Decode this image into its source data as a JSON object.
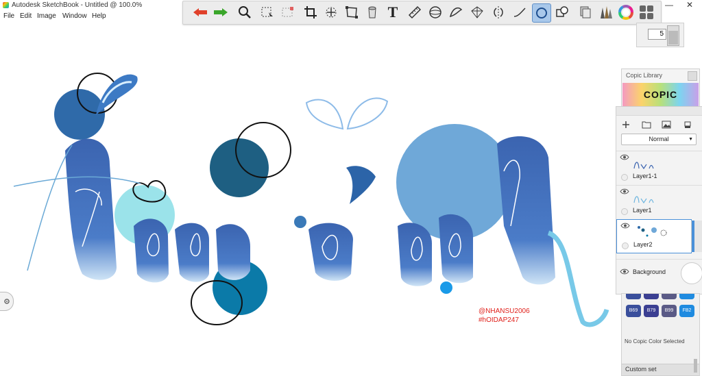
{
  "app": {
    "title": "Autodesk SketchBook - Untitled @ 100.0%",
    "window_controls": {
      "minimize": "—",
      "close": "✕"
    }
  },
  "menu": [
    "File",
    "Edit",
    "Image",
    "Window",
    "Help"
  ],
  "toolbar": {
    "tools": [
      {
        "name": "undo",
        "icon": "undo-arrow-icon",
        "color": "#e0402a"
      },
      {
        "name": "redo",
        "icon": "redo-arrow-icon",
        "color": "#3aa62a"
      },
      {
        "name": "zoom",
        "icon": "magnifier-icon"
      },
      {
        "name": "select",
        "icon": "selection-marquee-icon"
      },
      {
        "name": "lasso-select",
        "icon": "dashed-selection-icon"
      },
      {
        "name": "crop",
        "icon": "crop-icon"
      },
      {
        "name": "move-rotate",
        "icon": "transform-icon"
      },
      {
        "name": "distort",
        "icon": "distort-icon"
      },
      {
        "name": "fill",
        "icon": "bucket-icon"
      },
      {
        "name": "text",
        "icon": "text-icon",
        "label": "T"
      },
      {
        "name": "ruler",
        "icon": "ruler-icon"
      },
      {
        "name": "ellipse-guide",
        "icon": "ellipse-guide-icon"
      },
      {
        "name": "french-curve",
        "icon": "french-curve-icon"
      },
      {
        "name": "perspective",
        "icon": "perspective-icon"
      },
      {
        "name": "symmetry",
        "icon": "symmetry-icon"
      },
      {
        "name": "stroke",
        "icon": "stroke-icon"
      },
      {
        "name": "predictive-stroke",
        "icon": "circle-stroke-icon",
        "active": true
      },
      {
        "name": "shapes",
        "icon": "shapes-icon"
      },
      {
        "name": "layers",
        "icon": "layers-icon"
      },
      {
        "name": "brushes",
        "icon": "brushes-icon"
      },
      {
        "name": "color-wheel",
        "icon": "color-wheel-icon"
      },
      {
        "name": "copic-library",
        "icon": "grid-squares-icon"
      }
    ],
    "brush_size": "5"
  },
  "watermark": [
    "@NHANSU2006",
    "#hOIDAP247"
  ],
  "copic_library": {
    "title": "Copic Library",
    "logo": "COPIC"
  },
  "layers": {
    "blend_mode": "Normal",
    "items": [
      {
        "name": "Layer1-1"
      },
      {
        "name": "Layer1"
      },
      {
        "name": "Layer2",
        "selected": true
      }
    ],
    "background": {
      "name": "Background",
      "color": "#ffffff"
    }
  },
  "copic_colors": {
    "swatches": [
      {
        "code": "B69",
        "color": "#3a4f9c"
      },
      {
        "code": "B79",
        "color": "#3b3f92"
      },
      {
        "code": "B99",
        "color": "#5a5a86"
      },
      {
        "code": "FB2",
        "color": "#1f8be0"
      }
    ],
    "status": "No Copic Color Selected",
    "set_label": "Custom set"
  },
  "colors": {
    "accent_blue": "#4a90d9",
    "active_tool": "#a9c8ea",
    "watermark": "#e0201a"
  }
}
